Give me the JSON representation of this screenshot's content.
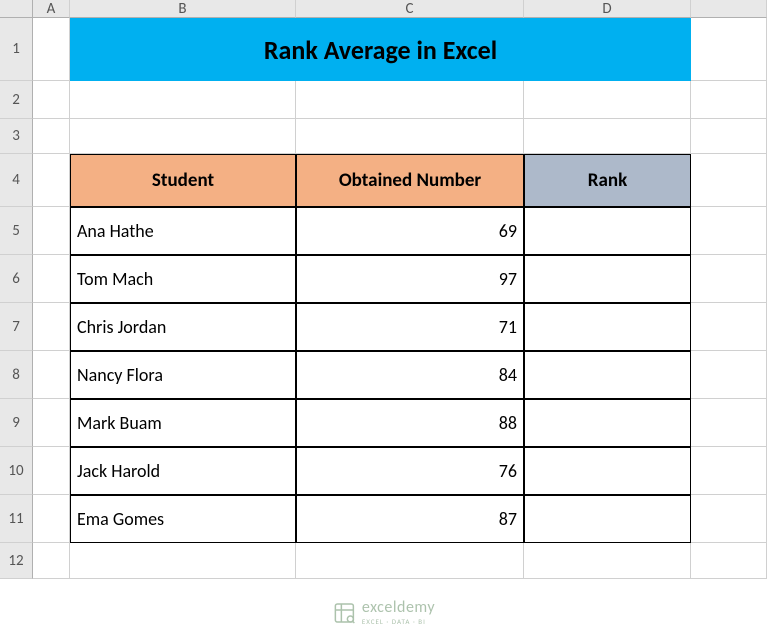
{
  "columns": [
    "A",
    "B",
    "C",
    "D"
  ],
  "rows": [
    "1",
    "2",
    "3",
    "4",
    "5",
    "6",
    "7",
    "8",
    "9",
    "10",
    "11",
    "12"
  ],
  "title": "Rank Average in Excel",
  "headers": {
    "student": "Student",
    "number": "Obtained Number",
    "rank": "Rank"
  },
  "data": [
    {
      "name": "Ana Hathe",
      "number": "69",
      "rank": ""
    },
    {
      "name": "Tom Mach",
      "number": "97",
      "rank": ""
    },
    {
      "name": "Chris Jordan",
      "number": "71",
      "rank": ""
    },
    {
      "name": "Nancy Flora",
      "number": "84",
      "rank": ""
    },
    {
      "name": "Mark Buam",
      "number": "88",
      "rank": ""
    },
    {
      "name": "Jack Harold",
      "number": "76",
      "rank": ""
    },
    {
      "name": "Ema Gomes",
      "number": "87",
      "rank": ""
    }
  ],
  "watermark": {
    "brand": "exceldemy",
    "sub": "EXCEL · DATA · BI"
  },
  "chart_data": {
    "type": "table",
    "title": "Rank Average in Excel",
    "columns": [
      "Student",
      "Obtained Number",
      "Rank"
    ],
    "rows": [
      [
        "Ana Hathe",
        69,
        null
      ],
      [
        "Tom Mach",
        97,
        null
      ],
      [
        "Chris Jordan",
        71,
        null
      ],
      [
        "Nancy Flora",
        84,
        null
      ],
      [
        "Mark Buam",
        88,
        null
      ],
      [
        "Jack Harold",
        76,
        null
      ],
      [
        "Ema Gomes",
        87,
        null
      ]
    ]
  }
}
